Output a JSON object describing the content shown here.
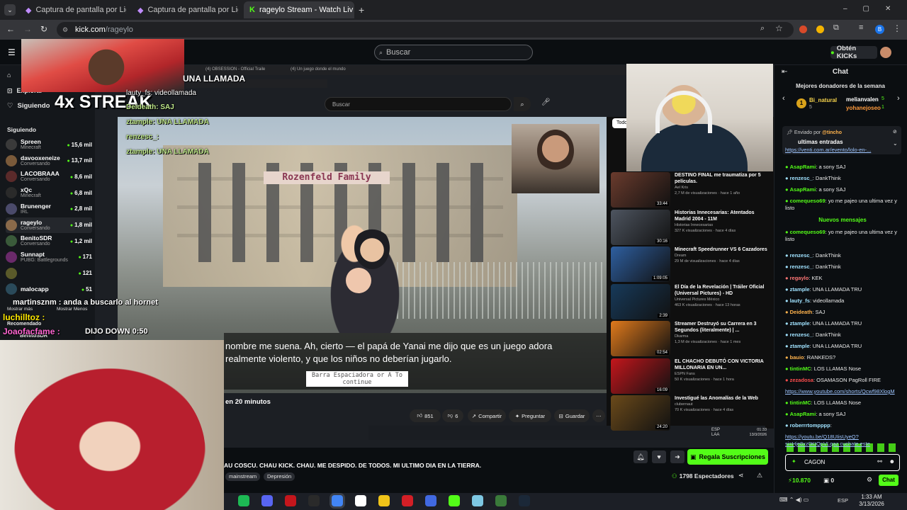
{
  "browser": {
    "tabs": [
      {
        "label": "Captura de pantalla por Lightsh"
      },
      {
        "label": "Captura de pantalla por Lightsh"
      },
      {
        "label": "rageylo Stream - Watch Liv"
      }
    ],
    "url_host": "kick.com",
    "url_path": "/rageylo"
  },
  "kick": {
    "search_placeholder": "Buscar",
    "get_kicks": "Obtén KICKs",
    "nav": {
      "home": "Home",
      "explore": "Explorar",
      "following": "Siguiendo"
    },
    "following_title": "Siguiendo",
    "channels": [
      {
        "name": "Spreen",
        "game": "Minecraft",
        "viewers": "15,6 mil"
      },
      {
        "name": "davooxeneize",
        "game": "Conversando",
        "viewers": "13,7 mil"
      },
      {
        "name": "LACOBRAAA",
        "game": "Conversando",
        "viewers": "8,6 mil"
      },
      {
        "name": "xQc",
        "game": "Minecraft",
        "viewers": "6,8 mil"
      },
      {
        "name": "Brunenger",
        "game": "IRL",
        "viewers": "2,8 mil"
      },
      {
        "name": "rageylo",
        "game": "Conversando",
        "viewers": "1,8 mil"
      },
      {
        "name": "BenitoSDR",
        "game": "Conversando",
        "viewers": "1,2 mil"
      }
    ],
    "channels_extra": [
      {
        "name": "Sunnapt",
        "game": "PUBG: Battlegrounds",
        "viewers": "171"
      },
      {
        "name": "",
        "game": "",
        "viewers": "121"
      },
      {
        "name": "malocapp",
        "game": "",
        "viewers": "51"
      }
    ],
    "show_more": "Mostrar más",
    "show_less": "Mostrar Menos",
    "recommended": "Recomendado",
    "rec_channel": "BenitoSDR"
  },
  "overlay": {
    "streak": "4x STREAK",
    "lines": [
      "lauty_fs: videollamada",
      "Deideath: SAJ",
      "ztample: UNA LLAMADA",
      "renzesc_:",
      "ztample: UNA LLAMADA"
    ],
    "tweet_top": "UNA LLAMADA",
    "martinsznm": "martinsznm : anda a buscarlo al hornet",
    "luchilltoz": "luchilltoz :",
    "joaofacfame": "Joaofacfame :",
    "dijo_down": "DIJO DOWN 0:50"
  },
  "game": {
    "sign": "Rozenfeld Family",
    "subtitle": "nombre me suena. Ah, cierto — el papá de Yanai me dijo que es un juego adora realmente violento, y que los niños no deberían jugarlo.",
    "space_prompt": "Barra Espaciadora or A To continue",
    "en_minutos": "en 20 minutos"
  },
  "youtube": {
    "search": "Buscar",
    "tab_a": "(4) OBSESSION - Official Traile",
    "tab_b": "(4) Un juego donde el mundo",
    "todo": "Todo",
    "actions": {
      "likes": "851",
      "dislikes": "6",
      "share": "Compartir",
      "ask": "Preguntar",
      "save": "Guardar"
    },
    "videos": [
      {
        "title": "DESTINO FINAL me traumatiza por 5 películas.",
        "channel": "Ael Kris",
        "meta": "2,7 M de visualizaciones · hace 1 año",
        "dur": "33:44",
        "color": "#6a3b2d"
      },
      {
        "title": "Historias Innecesarias: Atentados Madrid 2004 - 11M",
        "channel": "Historias Innecesarias",
        "meta": "327 K visualizaciones · hace 4 días",
        "dur": "30:16",
        "color": "#4e5560"
      },
      {
        "title": "Minecraft Speedrunner VS 6 Cazadores",
        "channel": "Dream",
        "meta": "29 M de visualizaciones · hace 4 días",
        "dur": "1:09:05",
        "color": "#2e5fa0"
      },
      {
        "title": "El Día de la Revelación | Tráiler Oficial (Universal Pictures) - HD",
        "channel": "Universal Pictures México",
        "meta": "463 K visualizaciones · hace 13 horas",
        "dur": "2:39",
        "color": "#173a5a"
      },
      {
        "title": "Streamer Destruyó su Carrera en 3 Segundos (literalmente) | ...",
        "channel": "Dkarma",
        "meta": "1,3 M de visualizaciones · hace 1 mes",
        "dur": "02:54",
        "color": "#e07a1c"
      },
      {
        "title": "EL CHACHO DEBUTÓ CON VICTORIA MILLONARIA EN UN...",
        "channel": "ESPN Fans",
        "meta": "50 K visualizaciones · hace 1 hora",
        "dur": "16:09",
        "color": "#c4161c"
      },
      {
        "title": "Investigué las Anomalías de la Web",
        "channel": "clubernaut",
        "meta": "70 K visualizaciones · hace 4 días",
        "dur": "24:20",
        "color": "#6b4a1a"
      }
    ],
    "win_lang": "ESP LAA",
    "win_time": "01:33 13/3/2026"
  },
  "stream": {
    "title": "AU COSCU. CHAU KICK. CHAU. ME DESPIDO. DE TODOS. MI ULTIMO DIA EN LA TIERRA.",
    "tags": [
      "mainstream",
      "Depresión"
    ],
    "viewers": "1798 Espectadores",
    "gift_subs": "Regala Suscripciones"
  },
  "chat": {
    "title": "Chat",
    "donors_title": "Mejores donadores de la semana",
    "donors": [
      {
        "name": "Bi_natural",
        "rank": "1",
        "amount": "5"
      },
      {
        "name": "melianvalen",
        "amount": "5"
      },
      {
        "name": "yohanejoseo",
        "amount": "1"
      }
    ],
    "pinned_by": "Enviado por",
    "pinned_user": "@tincho",
    "pinned_title": "ultimas entradas",
    "pinned_link": "https://venti.com.ar/evento/lolo-en-...",
    "messages_before": [
      {
        "user": "AsapRami",
        "text": ": a sony SAJ",
        "color": "#53fc18"
      },
      {
        "user": "renzesc_",
        "text": ": DankThink",
        "color": "#a0e2ff"
      },
      {
        "user": "AsapRami",
        "text": ": a sony SAJ",
        "color": "#53fc18"
      },
      {
        "user": "comequeso69",
        "text": ": yo me pajeo una ultima vez y listo",
        "color": "#53fc18"
      }
    ],
    "new_messages": "Nuevos mensajes",
    "messages_after": [
      {
        "user": "comequeso69",
        "text": ": yo me pajeo una ultima vez y listo",
        "color": "#53fc18"
      },
      {
        "user": "renzesc_",
        "text": ": DankThink",
        "color": "#a0e2ff"
      },
      {
        "user": "renzesc_",
        "text": ": DankThink",
        "color": "#a0e2ff"
      },
      {
        "user": "regaylo",
        "text": ": KEK",
        "color": "#ff7676"
      },
      {
        "user": "ztample",
        "text": ": UNA LLAMADA TRU",
        "color": "#a0e2ff"
      },
      {
        "user": "lauty_fs",
        "text": ": videollamada",
        "color": "#a0e2ff"
      },
      {
        "user": "Deideath",
        "text": ": SAJ",
        "color": "#ffb34d"
      },
      {
        "user": "ztample",
        "text": ": UNA LLAMADA TRU",
        "color": "#a0e2ff"
      },
      {
        "user": "renzesc_",
        "text": ": DankThink",
        "color": "#a0e2ff"
      },
      {
        "user": "ztample",
        "text": ": UNA LLAMADA TRU",
        "color": "#a0e2ff"
      },
      {
        "user": "bauio",
        "text": ": RANKEDS?",
        "color": "#ffb34d"
      },
      {
        "user": "tintinMC",
        "text": ": LOS LLAMAS Nose",
        "color": "#53fc18"
      },
      {
        "user": "zezadosa",
        "text": ": OSAMASON PagRoll FIRE",
        "color": "#ff4d4d"
      },
      {
        "user": "",
        "text": "https://www.youtube.com/shorts/Qcwf98XlogM",
        "color": "#9ec5ff"
      },
      {
        "user": "tintinMC",
        "text": ": LOS LLAMAS Nose",
        "color": "#53fc18"
      },
      {
        "user": "AsapRami",
        "text": ": a sony SAJ",
        "color": "#53fc18"
      },
      {
        "user": "roberrrtompppp",
        "text": ":",
        "color": "#a0e2ff"
      },
      {
        "user": "",
        "text": "https://youtu.be/Q18UIisUyeQ? si=Hje8xz0KtQpVLqaz cuchate este",
        "color": "#9ec5ff"
      }
    ],
    "input_value": "CAGON",
    "kicks": "10.870",
    "subs": "0",
    "send": "Chat"
  },
  "taskbar": {
    "time": "1:33 AM",
    "date": "3/13/2026",
    "lang": "ESP"
  }
}
